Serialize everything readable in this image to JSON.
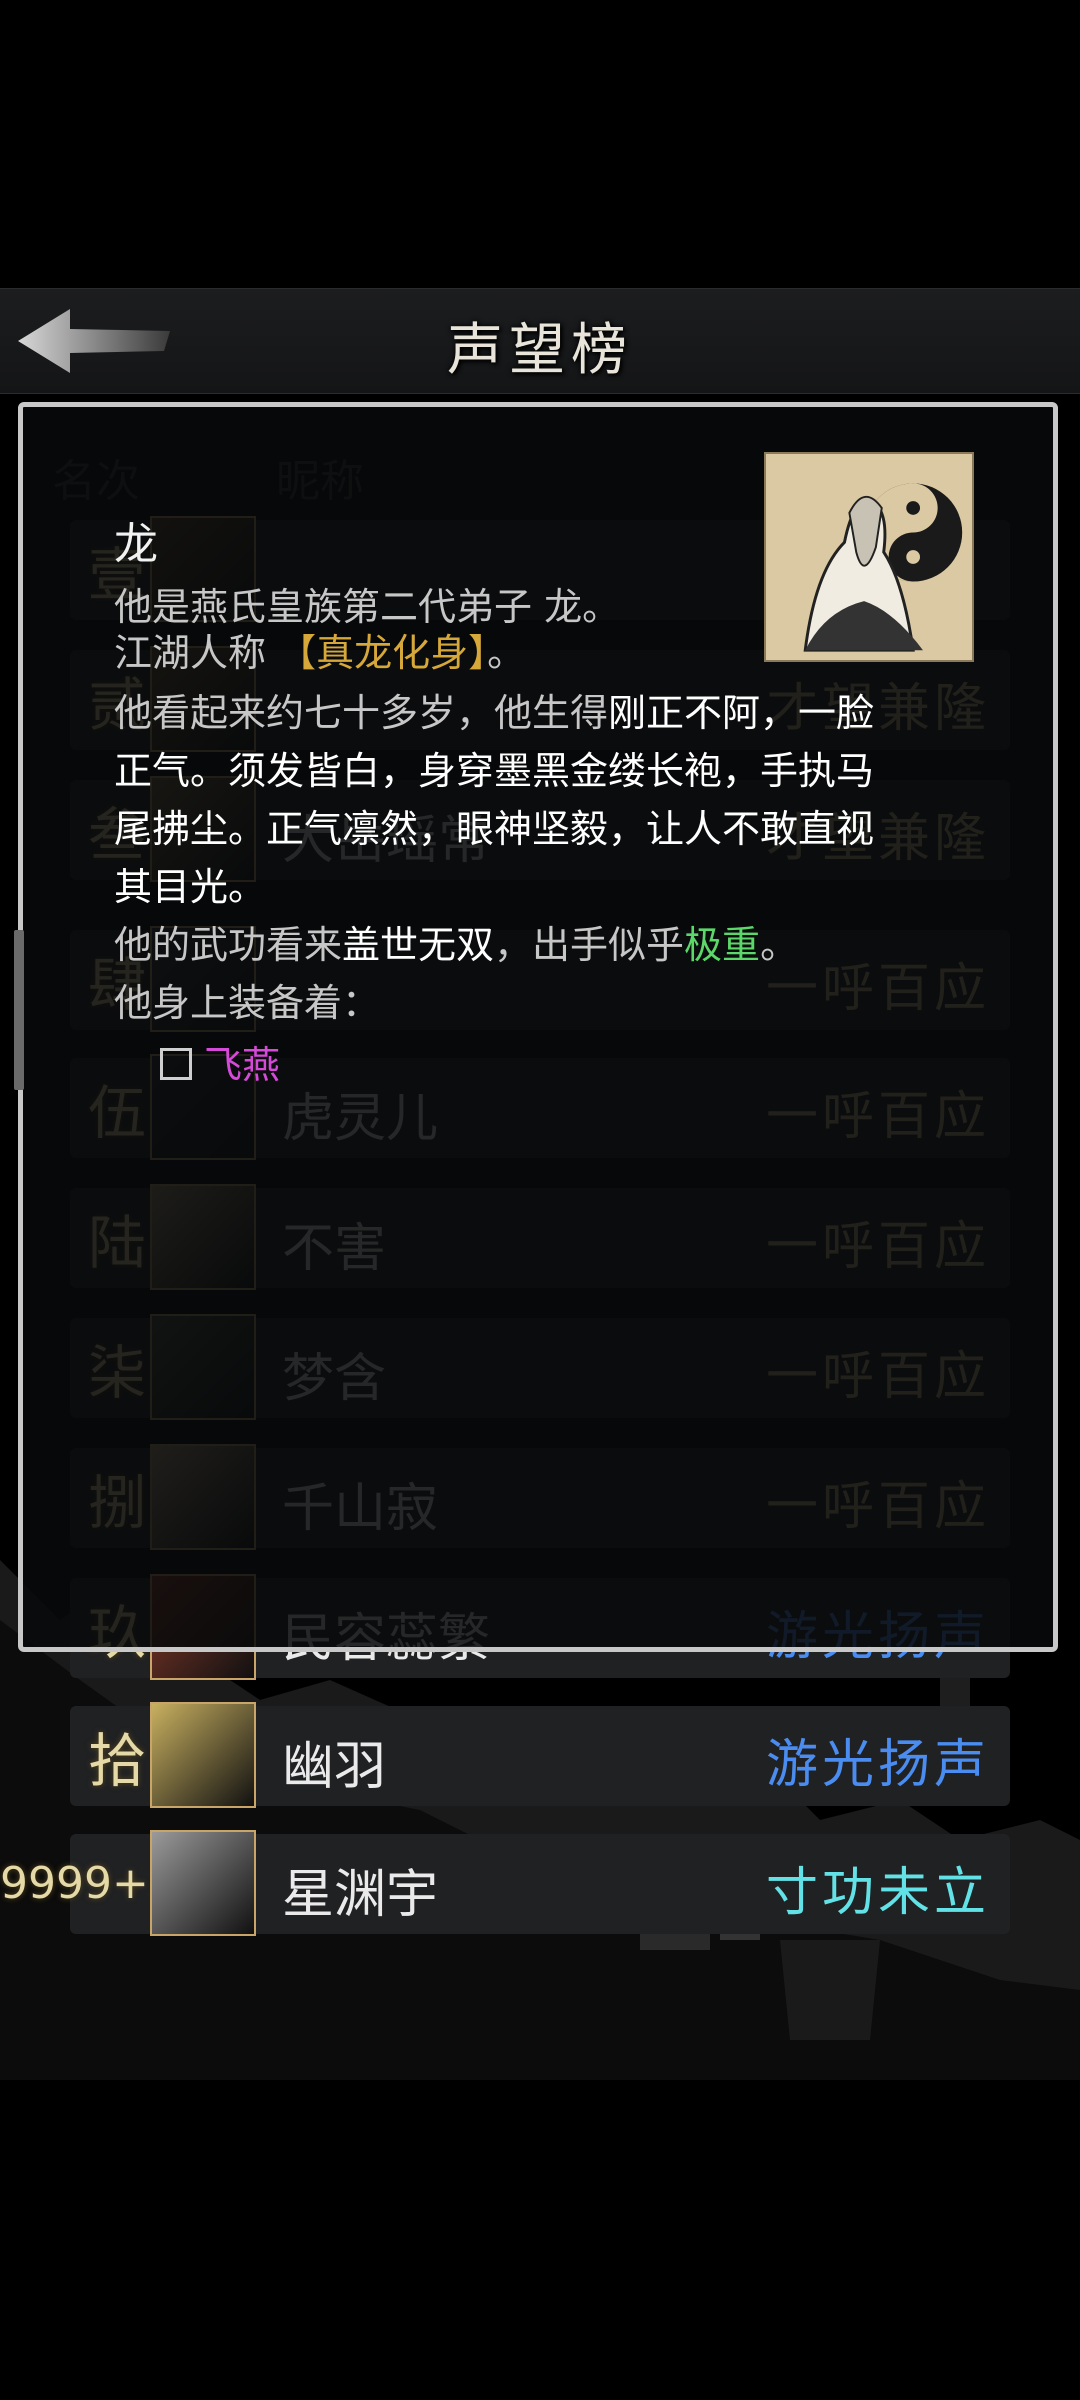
{
  "header": {
    "title": "声望榜"
  },
  "list": {
    "col_rank": "名次",
    "col_name": "昵称",
    "rows": [
      {
        "rank": "壹",
        "name": "",
        "fame": "",
        "fame_color": "#c9b88a"
      },
      {
        "rank": "贰",
        "name": "",
        "fame": "才望兼隆",
        "fame_color": "#c9b88a"
      },
      {
        "rank": "叁",
        "name": "大岳瑶常",
        "fame": "才望兼隆",
        "fame_color": "#c9b88a"
      },
      {
        "rank": "肆",
        "name": "",
        "fame": "一呼百应",
        "fame_color": "#c9b88a"
      },
      {
        "rank": "伍",
        "name": "虎灵儿",
        "fame": "一呼百应",
        "fame_color": "#c9b88a"
      },
      {
        "rank": "陆",
        "name": "不害",
        "fame": "一呼百应",
        "fame_color": "#c9b88a"
      },
      {
        "rank": "柒",
        "name": "梦含",
        "fame": "一呼百应",
        "fame_color": "#c9b88a"
      },
      {
        "rank": "捌",
        "name": "千山寂",
        "fame": "一呼百应",
        "fame_color": "#c9b88a"
      },
      {
        "rank": "玖",
        "name": "民容蕊繁",
        "fame": "游光扬声",
        "fame_color": "#4a8cf0"
      },
      {
        "rank": "拾",
        "name": "幽羽",
        "fame": "游光扬声",
        "fame_color": "#4a8cf0"
      },
      {
        "rank": "9999+",
        "name": "星渊宇",
        "fame": "寸功未立",
        "fame_color": "#62e2e6"
      }
    ]
  },
  "dialog": {
    "name": "龙",
    "line1": "他是燕氏皇族第二代弟子 龙。",
    "line2_prefix": "江湖人称 ",
    "line2_title": "【真龙化身】",
    "line2_suffix": "。",
    "desc_a": "他看起来约七十多岁，他生得",
    "desc_b": "刚正不阿，一脸",
    "desc_line2": "正气。须发皆白，身穿墨黑金缕长袍，手执马",
    "desc_line3": "尾拂尘。正气凛然，眼神坚毅，让人不敢直视",
    "desc_line4": "其目光。",
    "martial_a": "他的武功看来",
    "martial_b": "盖世无双",
    "martial_c": "，出手似乎",
    "martial_d": "极重",
    "martial_e": "。",
    "equip_heading": "他身上装备着：",
    "equip_item": "飞燕"
  },
  "colors": {
    "fame_gold": "#c9b88a",
    "fame_blue": "#4a8cf0",
    "fame_cyan": "#62e2e6",
    "equip_purple": "#d64ad9"
  },
  "icons": {
    "back": "back-arrow-icon"
  }
}
